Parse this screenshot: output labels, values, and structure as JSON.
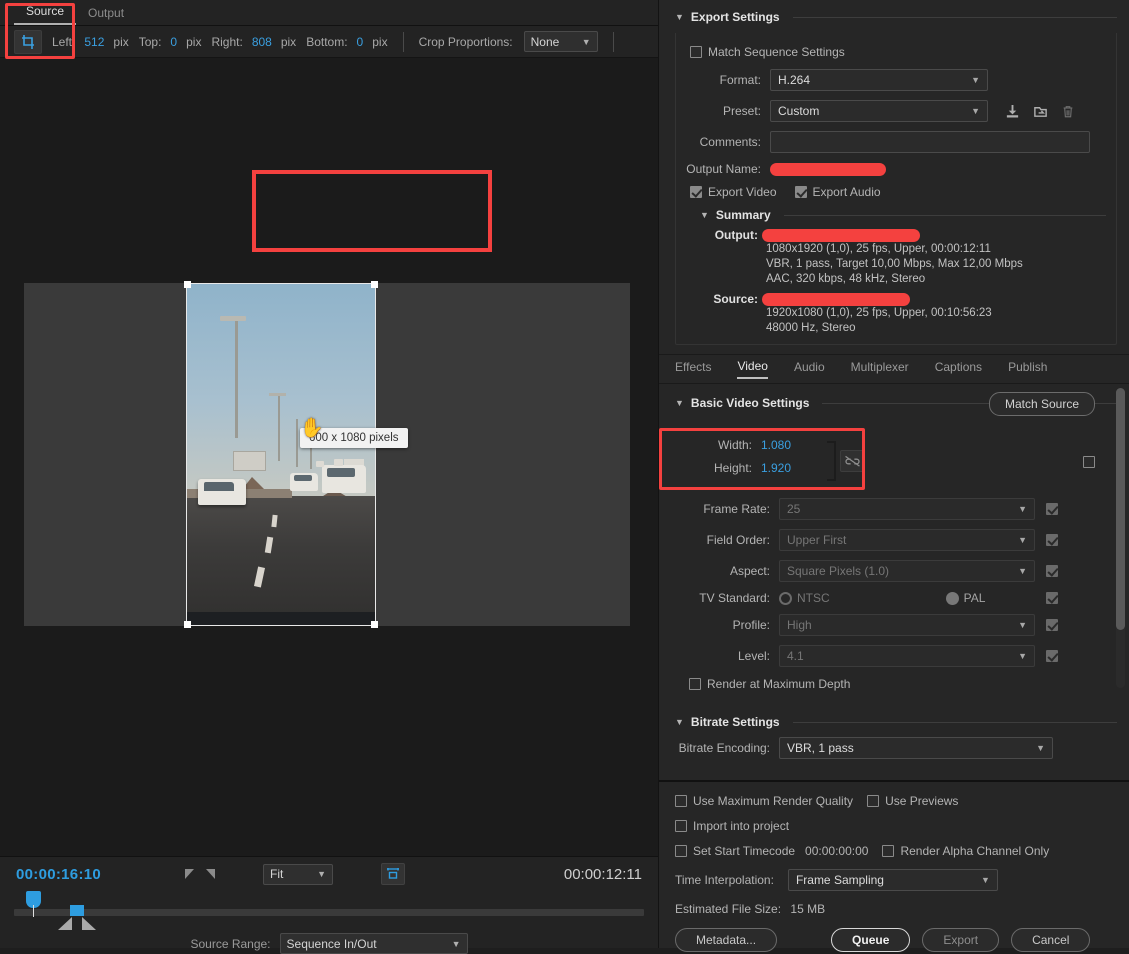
{
  "source_panel": {
    "tabs": [
      {
        "label": "Source",
        "active": true
      },
      {
        "label": "Output",
        "active": false
      }
    ],
    "crop_toolbar": {
      "tool_icon": "crop-icon",
      "left_label": "Left:",
      "left_value": "512",
      "top_label": "Top:",
      "top_value": "0",
      "right_label": "Right:",
      "right_value": "808",
      "bottom_label": "Bottom:",
      "bottom_value": "0",
      "unit": "pix",
      "proportions_label": "Crop Proportions:",
      "proportions_value": "None"
    },
    "preview": {
      "tooltip": "600 x 1080 pixels",
      "cursor_icon": "hand-cursor-icon"
    },
    "timeline": {
      "current_time": "00:00:16:10",
      "duration": "00:00:12:11",
      "zoom_level": "Fit",
      "aspect_icon": "safe-margins-icon",
      "source_range_label": "Source Range:",
      "source_range_value": "Sequence In/Out"
    }
  },
  "export": {
    "settings_title": "Export Settings",
    "match_sequence_label": "Match Sequence Settings",
    "match_sequence_checked": false,
    "format_label": "Format:",
    "format_value": "H.264",
    "preset_label": "Preset:",
    "preset_value": "Custom",
    "preset_icons": [
      "save-preset-icon",
      "import-preset-icon",
      "delete-preset-icon"
    ],
    "comments_label": "Comments:",
    "comments_value": "",
    "output_name_label": "Output Name:",
    "output_name_value": "",
    "export_video_label": "Export Video",
    "export_video_checked": true,
    "export_audio_label": "Export Audio",
    "export_audio_checked": true,
    "summary": {
      "title": "Summary",
      "output_key": "Output:",
      "output_lines": [
        "1080x1920 (1,0), 25 fps, Upper, 00:00:12:11",
        "VBR, 1 pass, Target 10,00 Mbps, Max 12,00 Mbps",
        "AAC, 320 kbps, 48 kHz, Stereo"
      ],
      "source_key": "Source:",
      "source_lines": [
        "1920x1080 (1,0), 25 fps, Upper, 00:10:56:23",
        "48000 Hz, Stereo"
      ]
    },
    "tabs": [
      {
        "label": "Effects",
        "active": false
      },
      {
        "label": "Video",
        "active": true
      },
      {
        "label": "Audio",
        "active": false
      },
      {
        "label": "Multiplexer",
        "active": false
      },
      {
        "label": "Captions",
        "active": false
      },
      {
        "label": "Publish",
        "active": false
      }
    ],
    "video": {
      "group_title": "Basic Video Settings",
      "match_source_label": "Match Source",
      "width_label": "Width:",
      "width_value": "1.080",
      "height_label": "Height:",
      "height_value": "1.920",
      "link_icon": "broken-link-icon",
      "link_checkbox_checked": false,
      "rows": [
        {
          "label": "Frame Rate:",
          "value": "25",
          "checked": true,
          "disabled": true
        },
        {
          "label": "Field Order:",
          "value": "Upper First",
          "checked": true,
          "disabled": true
        },
        {
          "label": "Aspect:",
          "value": "Square Pixels (1.0)",
          "checked": true,
          "disabled": true
        },
        {
          "label": "Profile:",
          "value": "High",
          "checked": true,
          "disabled": true
        },
        {
          "label": "Level:",
          "value": "4.1",
          "checked": true,
          "disabled": true
        }
      ],
      "tv_standard_label": "TV Standard:",
      "tv_ntsc_label": "NTSC",
      "tv_pal_label": "PAL",
      "tv_selected": "PAL",
      "tv_checked": true,
      "render_max_depth_label": "Render at Maximum Depth",
      "render_max_depth_checked": false
    },
    "bitrate": {
      "group_title": "Bitrate Settings",
      "encoding_label": "Bitrate Encoding:",
      "encoding_value": "VBR, 1 pass"
    },
    "footer": {
      "use_max_render_label": "Use Maximum Render Quality",
      "use_max_render_checked": false,
      "use_previews_label": "Use Previews",
      "use_previews_checked": false,
      "import_project_label": "Import into project",
      "import_project_checked": false,
      "set_timecode_label": "Set Start Timecode",
      "set_timecode_checked": false,
      "timecode_value": "00:00:00:00",
      "render_alpha_label": "Render Alpha Channel Only",
      "render_alpha_checked": false,
      "time_interp_label": "Time Interpolation:",
      "time_interp_value": "Frame Sampling",
      "est_size_label": "Estimated File Size:",
      "est_size_value": "15 MB",
      "metadata_button": "Metadata...",
      "queue_button": "Queue",
      "export_button": "Export",
      "cancel_button": "Cancel"
    }
  },
  "colors": {
    "accent_blue": "#3a9fe0",
    "highlight_red": "#f4413f",
    "panel_bg": "#262626"
  }
}
